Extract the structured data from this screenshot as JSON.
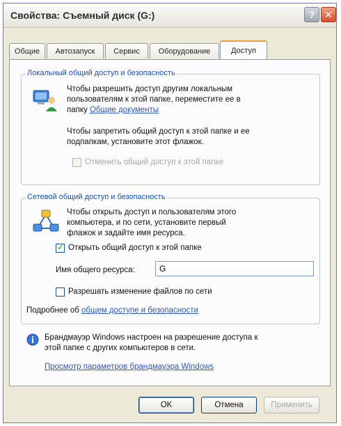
{
  "window": {
    "title": "Свойства: Съемный диск (G:)"
  },
  "titlebar": {
    "help_label": "?",
    "close_label": "✕"
  },
  "tabs": [
    {
      "label": "Общие"
    },
    {
      "label": "Автозапуск"
    },
    {
      "label": "Сервис"
    },
    {
      "label": "Оборудование"
    },
    {
      "label": "Доступ"
    }
  ],
  "local_group": {
    "title": "Локальный общий доступ и безопасность",
    "para1_line1": "Чтобы разрешить доступ другим локальным",
    "para1_line2": "пользователям к этой папке, переместите ее в",
    "para1_prefix": "папку",
    "para1_link": "Общие документы",
    "para2_line1": "Чтобы запретить общий доступ к этой папке и ее",
    "para2_line2": "подпапкам, установите этот флажок.",
    "checkbox_label": "Отменить общий доступ к этой папке"
  },
  "network_group": {
    "title": "Сетевой общий доступ и безопасность",
    "para_line1": "Чтобы открыть доступ и пользователям этого",
    "para_line2": "компьютера, и по сети, установите первый",
    "para_line3": "флажок и задайте имя ресурса.",
    "share_checkbox_label": "Открыть общий доступ к этой папке",
    "share_name_label": "Имя общего ресурса:",
    "share_name_value": "G",
    "allow_changes_label": "Разрешать изменение файлов по сети",
    "more_prefix": "Подробнее об",
    "more_link": "общем доступе и безопасности"
  },
  "firewall": {
    "info_line1": "Брандмауэр Windows настроен на разрешение доступа к",
    "info_line2": "этой папке с других компьютеров в сети.",
    "link": "Просмотр параметров брандмауэра Windows"
  },
  "buttons": {
    "ok": "OK",
    "cancel": "Отмена",
    "apply": "Применить"
  },
  "colors": {
    "accent_link": "#2e57b8",
    "group_title": "#1a4fa8",
    "tab_highlight": "#e9a23a"
  }
}
